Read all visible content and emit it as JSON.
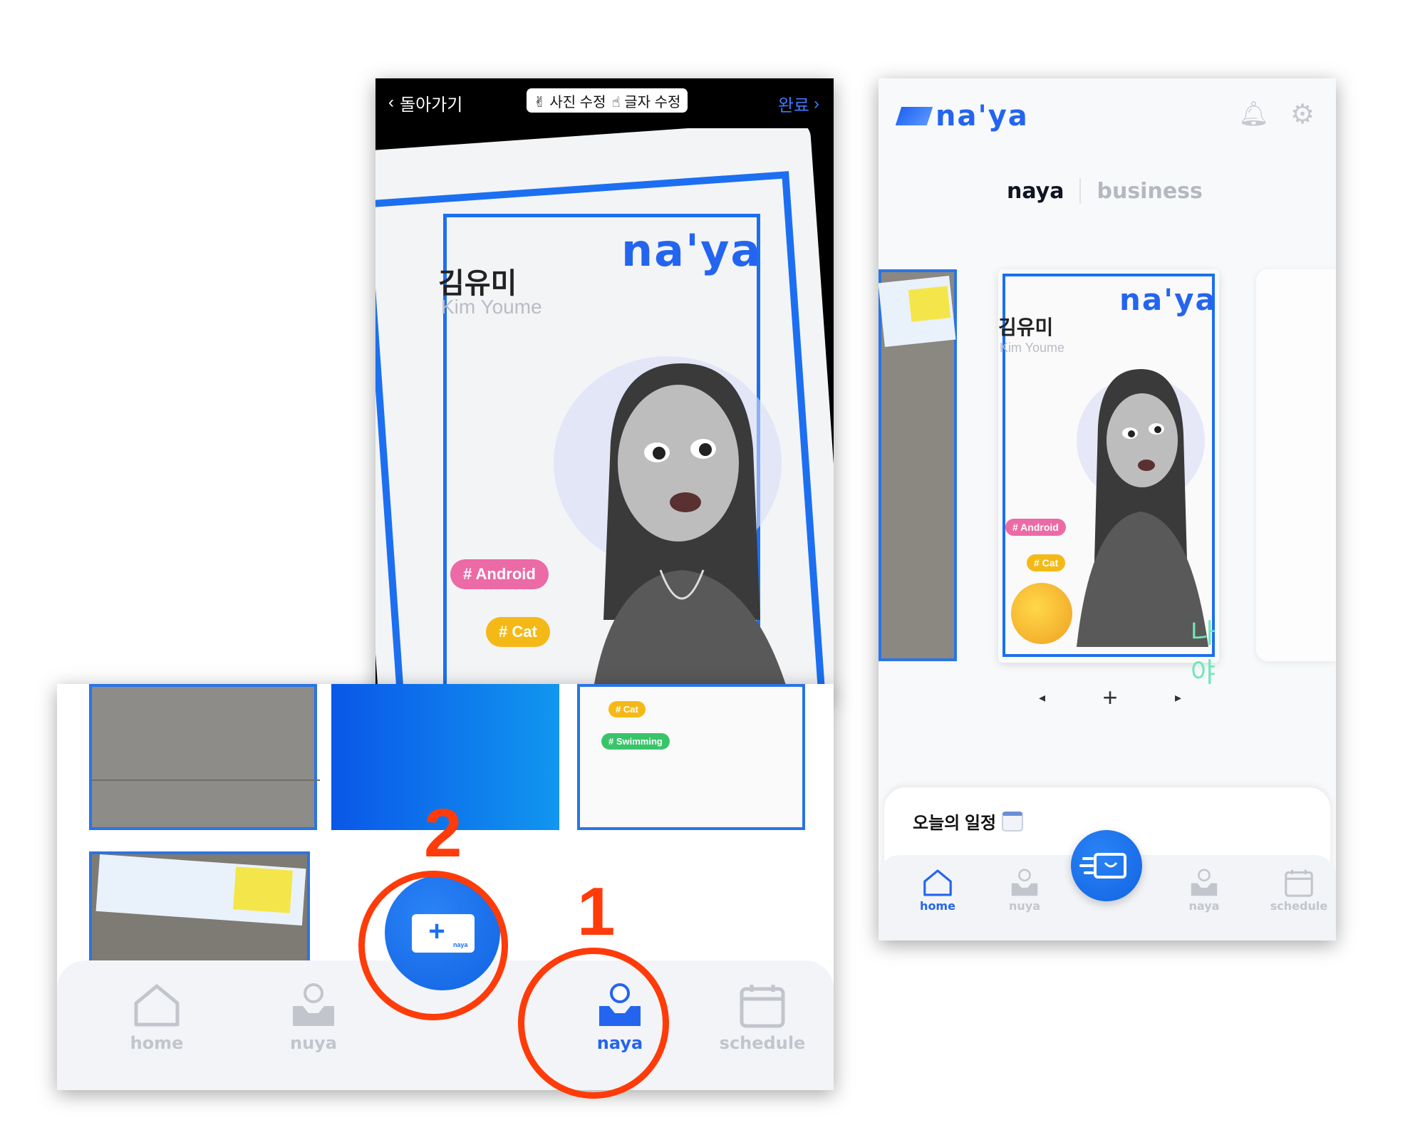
{
  "editor": {
    "back_label": "돌아가기",
    "edit_photo": "✌ 사진 수정",
    "edit_text": "☝ 글자 수정",
    "done_label": "완료",
    "card": {
      "logo": "na'ya",
      "name_ko": "김유미",
      "name_en": "Kim Youme",
      "tags": [
        "# Android",
        "# Cat"
      ]
    }
  },
  "left_phone": {
    "thumb_tags": [
      "# Cat",
      "# Swimming"
    ],
    "fab_mini_label": "naya",
    "nav": [
      {
        "label": "home",
        "icon": "home-icon",
        "active": false
      },
      {
        "label": "nuya",
        "icon": "nuya-inbox-icon",
        "active": false
      },
      {
        "label": "naya",
        "icon": "naya-inbox-icon",
        "active": true
      },
      {
        "label": "schedule",
        "icon": "calendar-icon",
        "active": false
      }
    ]
  },
  "annotations": {
    "step_1": "1",
    "step_2": "2",
    "color": "#ff3b0a"
  },
  "right_phone": {
    "logo": "na'ya",
    "tabs": {
      "naya": "naya",
      "business": "business"
    },
    "card": {
      "logo": "na'ya",
      "name_ko": "김유미",
      "name_en": "Kim Youme",
      "tags": [
        "# Android",
        "# Cat"
      ],
      "sticker_text": "나야"
    },
    "pager": {
      "prev": "◂",
      "add": "+",
      "next": "▸"
    },
    "schedule_title": "오늘의 일정",
    "nav": [
      {
        "label": "home",
        "active": true
      },
      {
        "label": "nuya",
        "active": false
      },
      {
        "label": "naya",
        "active": false
      },
      {
        "label": "schedule",
        "active": false
      }
    ]
  },
  "colors": {
    "brand_blue": "#2465ef",
    "nav_inactive": "#c2c6cc"
  }
}
